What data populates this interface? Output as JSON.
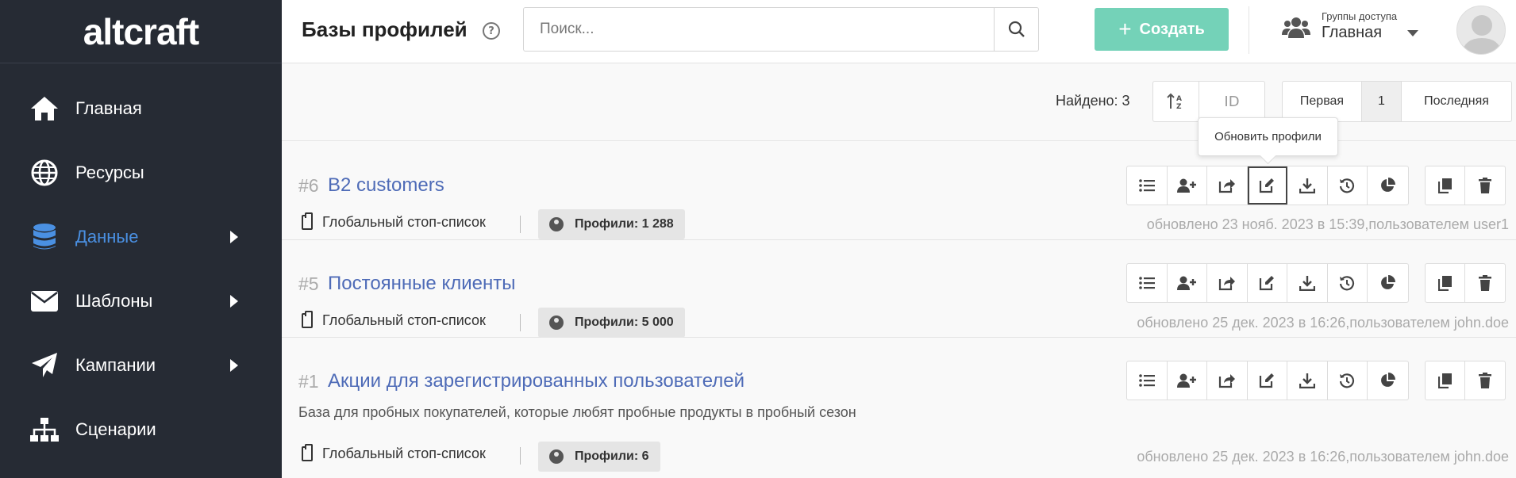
{
  "sidebar": {
    "logo": "altcraft",
    "items": [
      {
        "label": "Главная",
        "icon": "home-icon",
        "active": false,
        "has_submenu": false
      },
      {
        "label": "Ресурсы",
        "icon": "globe-icon",
        "active": false,
        "has_submenu": false
      },
      {
        "label": "Данные",
        "icon": "database-icon",
        "active": true,
        "has_submenu": true
      },
      {
        "label": "Шаблоны",
        "icon": "envelope-icon",
        "active": false,
        "has_submenu": true
      },
      {
        "label": "Кампании",
        "icon": "paper-plane-icon",
        "active": false,
        "has_submenu": true
      },
      {
        "label": "Сценарии",
        "icon": "sitemap-icon",
        "active": false,
        "has_submenu": false
      }
    ]
  },
  "header": {
    "title": "Базы профилей",
    "help": "?",
    "search_placeholder": "Поиск...",
    "create_label": "Создать",
    "create_plus": "+",
    "access_group_label": "Группы доступа",
    "access_group_value": "Главная"
  },
  "toolbar": {
    "found_text": "Найдено: 3",
    "sort_field": "ID",
    "pager": {
      "first": "Первая",
      "current": "1",
      "last": "Последняя"
    }
  },
  "tooltip": "Обновить профили",
  "colors": {
    "sidebar_bg": "#262b34",
    "active": "#4a90e2",
    "create_btn": "#74d2b8",
    "title_link": "#4e6bb7"
  },
  "rows": [
    {
      "id": "#6",
      "title": "B2 customers",
      "description": "",
      "stoplist": "Глобальный стоп-список",
      "profiles": "Профили: 1 288",
      "updated": "обновлено 23 нояб. 2023 в 15:39,пользователем user1"
    },
    {
      "id": "#5",
      "title": "Постоянные клиенты",
      "description": "",
      "stoplist": "Глобальный стоп-список",
      "profiles": "Профили: 5 000",
      "updated": "обновлено 25 дек. 2023 в 16:26,пользователем john.doe"
    },
    {
      "id": "#1",
      "title": "Акции для зарегистрированных пользователей",
      "description": "База для пробных покупателей, которые любят пробные продукты в пробный сезон",
      "stoplist": "Глобальный стоп-список",
      "profiles": "Профили: 6",
      "updated": "обновлено 25 дек. 2023 в 16:26,пользователем john.doe"
    }
  ],
  "row_actions": [
    "list-icon",
    "user-plus-icon",
    "share-icon",
    "edit-icon",
    "download-icon",
    "history-icon",
    "pie-chart-icon"
  ],
  "row_actions2": [
    "copy-icon",
    "trash-icon"
  ]
}
